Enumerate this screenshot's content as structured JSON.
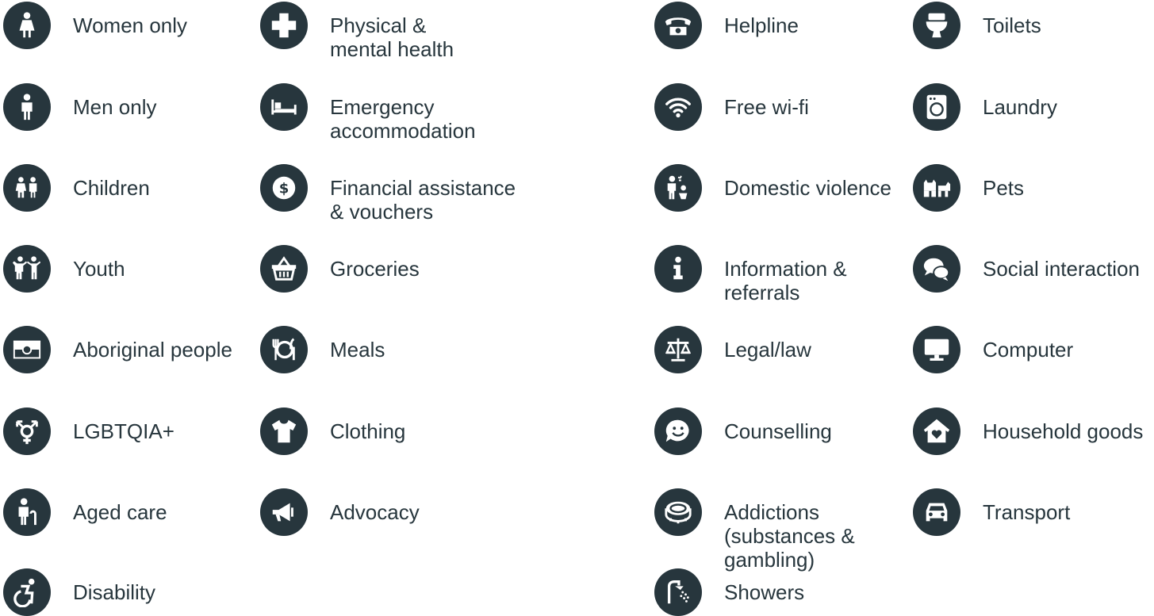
{
  "colors": {
    "icon_background": "#27363d",
    "icon_glyph": "#ffffff",
    "text": "#27363d",
    "page_background": "#ffffff"
  },
  "columns": [
    {
      "items": [
        {
          "icon": "woman-icon",
          "lines": [
            "Women only"
          ]
        },
        {
          "icon": "man-icon",
          "lines": [
            "Men only"
          ]
        },
        {
          "icon": "children-icon",
          "lines": [
            "Children"
          ]
        },
        {
          "icon": "youth-icon",
          "lines": [
            "Youth"
          ]
        },
        {
          "icon": "aboriginal-flag-icon",
          "lines": [
            "Aboriginal people"
          ]
        },
        {
          "icon": "transgender-symbol-icon",
          "lines": [
            "LGBTQIA+"
          ]
        },
        {
          "icon": "elderly-person-with-cane-icon",
          "lines": [
            "Aged care"
          ]
        },
        {
          "icon": "wheelchair-icon",
          "lines": [
            "Disability"
          ]
        }
      ]
    },
    {
      "items": [
        {
          "icon": "medical-cross-icon",
          "lines": [
            "Physical &",
            "mental health"
          ]
        },
        {
          "icon": "bed-icon",
          "lines": [
            "Emergency",
            "accommodation"
          ]
        },
        {
          "icon": "dollar-coin-icon",
          "lines": [
            "Financial assistance",
            "& vouchers"
          ]
        },
        {
          "icon": "shopping-basket-icon",
          "lines": [
            "Groceries"
          ]
        },
        {
          "icon": "plate-cutlery-icon",
          "lines": [
            "Meals"
          ]
        },
        {
          "icon": "t-shirt-icon",
          "lines": [
            "Clothing"
          ]
        },
        {
          "icon": "megaphone-icon",
          "lines": [
            "Advocacy"
          ]
        }
      ]
    },
    {
      "items": [
        {
          "icon": "telephone-icon",
          "lines": [
            "Helpline"
          ]
        },
        {
          "icon": "wifi-icon",
          "lines": [
            "Free wi-fi"
          ]
        },
        {
          "icon": "domestic-violence-icon",
          "lines": [
            "Domestic violence"
          ]
        },
        {
          "icon": "info-icon",
          "lines": [
            "Information &",
            "referrals"
          ]
        },
        {
          "icon": "scales-icon",
          "lines": [
            "Legal/law"
          ]
        },
        {
          "icon": "smiley-speech-icon",
          "lines": [
            "Counselling"
          ]
        },
        {
          "icon": "poker-chip-icon",
          "lines": [
            "Addictions",
            "(substances &",
            "gambling)"
          ]
        },
        {
          "icon": "shower-icon",
          "lines": [
            "Showers"
          ]
        }
      ]
    },
    {
      "items": [
        {
          "icon": "toilet-icon",
          "lines": [
            "Toilets"
          ]
        },
        {
          "icon": "washing-machine-icon",
          "lines": [
            "Laundry"
          ]
        },
        {
          "icon": "cat-dog-icon",
          "lines": [
            "Pets"
          ]
        },
        {
          "icon": "chat-bubbles-icon",
          "lines": [
            "Social interaction"
          ]
        },
        {
          "icon": "computer-monitor-icon",
          "lines": [
            "Computer"
          ]
        },
        {
          "icon": "house-heart-icon",
          "lines": [
            "Household goods"
          ]
        },
        {
          "icon": "car-icon",
          "lines": [
            "Transport"
          ]
        }
      ]
    }
  ]
}
